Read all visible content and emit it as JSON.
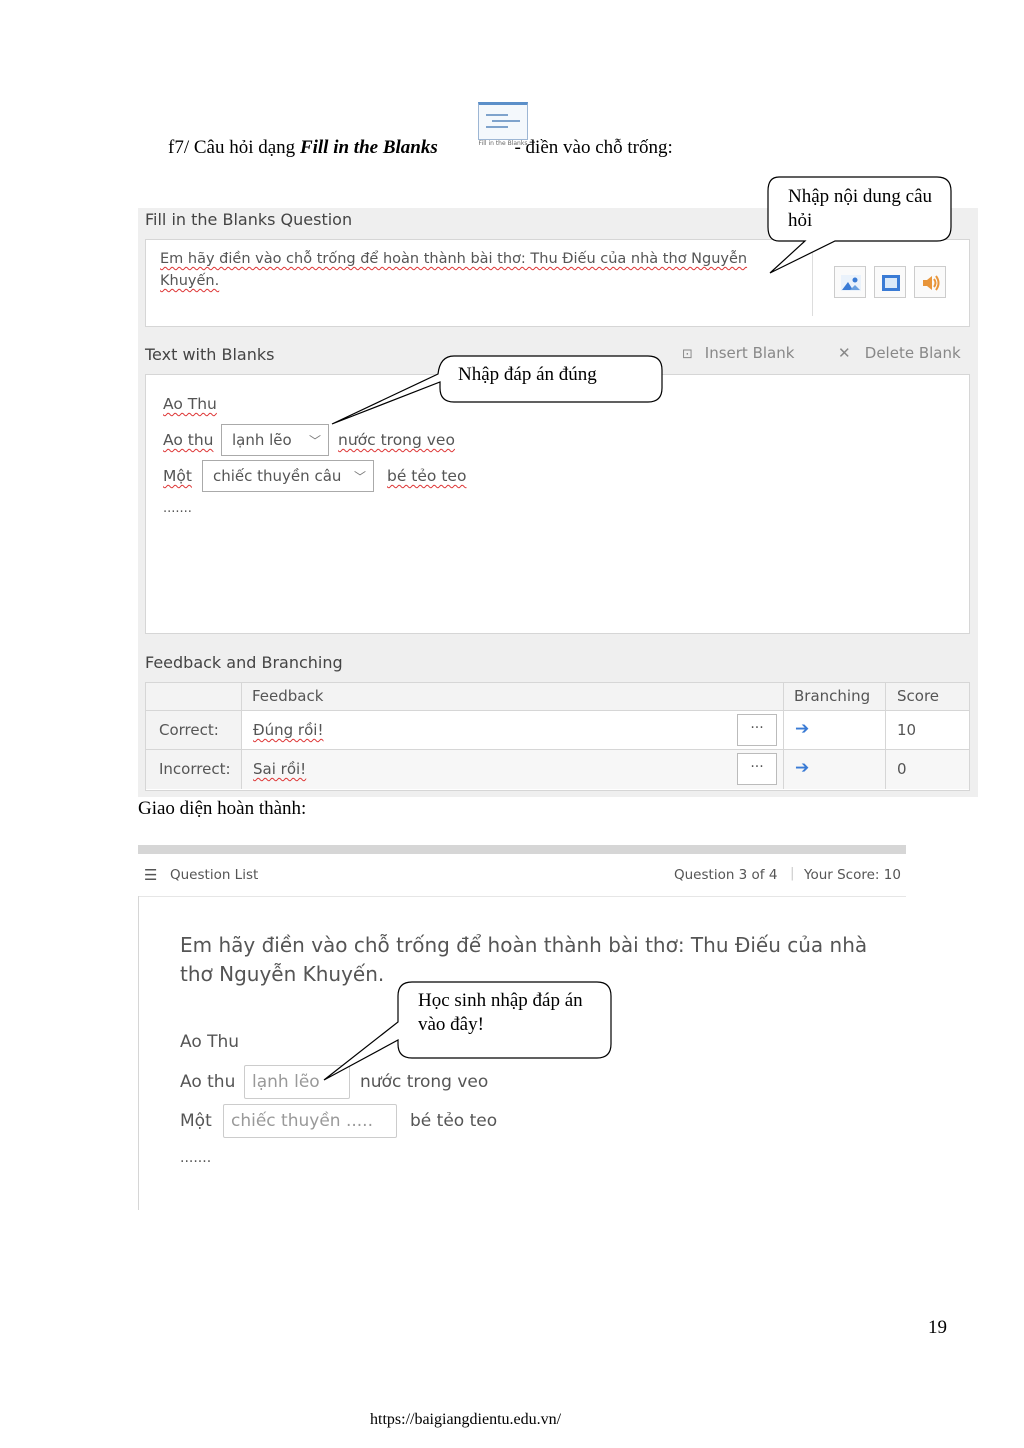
{
  "heading": {
    "prefix": "f7/ Câu hỏi  dạng ",
    "emph": "Fill in the Blanks",
    "suffix": " - điền vào chỗ trống:",
    "icon_caption": "Fill in the Blanks"
  },
  "editor": {
    "question_title": "Fill in the Blanks Question",
    "question_text": "Em hãy điền vào chỗ trống để hoàn thành bài thơ: Thu Điếu của nhà thơ Nguyễn Khuyến.",
    "media_buttons": [
      "image-icon",
      "video-icon",
      "audio-icon"
    ],
    "blanks_title": "Text with Blanks",
    "insert_blank": "Insert Blank",
    "delete_blank": "Delete Blank",
    "lines": {
      "l1": "Ao Thu",
      "l2_before": "Ao thu",
      "l2_blank": "lạnh lẽo",
      "l2_after": "nước trong veo",
      "l3_before": "Một",
      "l3_blank": "chiếc thuyền câu",
      "l3_after": "bé tẻo teo",
      "l4": "......."
    },
    "feedback_title": "Feedback and Branching",
    "table": {
      "headers": [
        "Feedback",
        "Branching",
        "Score"
      ],
      "rows": [
        {
          "label": "Correct:",
          "feedback": "Đúng rồi!",
          "dots": "···",
          "branch": "➔",
          "score": "10"
        },
        {
          "label": "Incorrect:",
          "feedback": "Sai rồi!",
          "dots": "···",
          "branch": "➔",
          "score": "0"
        }
      ]
    }
  },
  "callouts": {
    "c1": "Nhập nội dung câu hỏi",
    "c2": "Nhập đáp án đúng",
    "c3": "Học sinh nhập đáp án vào đây!"
  },
  "done_label": "Giao diện hoàn thành:",
  "player": {
    "question_list": "Question List",
    "progress": "Question 3 of 4",
    "score": "Your Score: 10",
    "question": "Em hãy điền vào chỗ trống để hoàn thành bài thơ: Thu Điếu của nhà thơ Nguyễn Khuyến.",
    "l1": "Ao Thu",
    "l2_before": "Ao thu",
    "l2_input": "lạnh lẽo",
    "l2_after": "nước trong veo",
    "l3_before": "Một",
    "l3_input": "chiếc thuyền .....",
    "l3_after": "bé tẻo teo",
    "l4": "......."
  },
  "page_number": "19",
  "footer_url": "https://baigiangdientu.edu.vn/"
}
